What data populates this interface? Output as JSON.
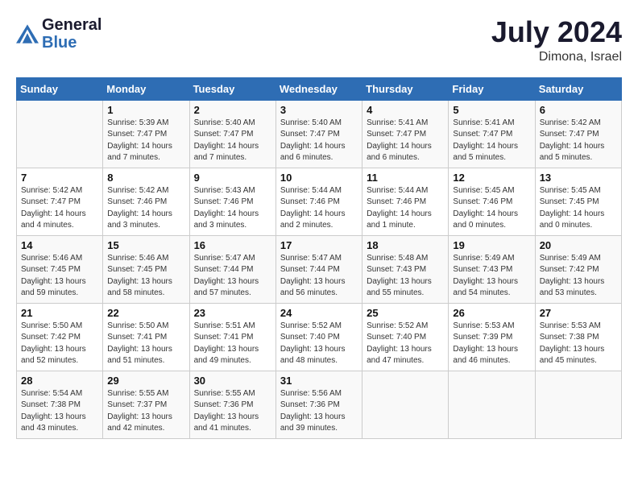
{
  "header": {
    "logo_line1": "General",
    "logo_line2": "Blue",
    "month": "July 2024",
    "location": "Dimona, Israel"
  },
  "days_of_week": [
    "Sunday",
    "Monday",
    "Tuesday",
    "Wednesday",
    "Thursday",
    "Friday",
    "Saturday"
  ],
  "weeks": [
    [
      {
        "day": "",
        "info": ""
      },
      {
        "day": "1",
        "info": "Sunrise: 5:39 AM\nSunset: 7:47 PM\nDaylight: 14 hours\nand 7 minutes."
      },
      {
        "day": "2",
        "info": "Sunrise: 5:40 AM\nSunset: 7:47 PM\nDaylight: 14 hours\nand 7 minutes."
      },
      {
        "day": "3",
        "info": "Sunrise: 5:40 AM\nSunset: 7:47 PM\nDaylight: 14 hours\nand 6 minutes."
      },
      {
        "day": "4",
        "info": "Sunrise: 5:41 AM\nSunset: 7:47 PM\nDaylight: 14 hours\nand 6 minutes."
      },
      {
        "day": "5",
        "info": "Sunrise: 5:41 AM\nSunset: 7:47 PM\nDaylight: 14 hours\nand 5 minutes."
      },
      {
        "day": "6",
        "info": "Sunrise: 5:42 AM\nSunset: 7:47 PM\nDaylight: 14 hours\nand 5 minutes."
      }
    ],
    [
      {
        "day": "7",
        "info": "Sunrise: 5:42 AM\nSunset: 7:47 PM\nDaylight: 14 hours\nand 4 minutes."
      },
      {
        "day": "8",
        "info": "Sunrise: 5:42 AM\nSunset: 7:46 PM\nDaylight: 14 hours\nand 3 minutes."
      },
      {
        "day": "9",
        "info": "Sunrise: 5:43 AM\nSunset: 7:46 PM\nDaylight: 14 hours\nand 3 minutes."
      },
      {
        "day": "10",
        "info": "Sunrise: 5:44 AM\nSunset: 7:46 PM\nDaylight: 14 hours\nand 2 minutes."
      },
      {
        "day": "11",
        "info": "Sunrise: 5:44 AM\nSunset: 7:46 PM\nDaylight: 14 hours\nand 1 minute."
      },
      {
        "day": "12",
        "info": "Sunrise: 5:45 AM\nSunset: 7:46 PM\nDaylight: 14 hours\nand 0 minutes."
      },
      {
        "day": "13",
        "info": "Sunrise: 5:45 AM\nSunset: 7:45 PM\nDaylight: 14 hours\nand 0 minutes."
      }
    ],
    [
      {
        "day": "14",
        "info": "Sunrise: 5:46 AM\nSunset: 7:45 PM\nDaylight: 13 hours\nand 59 minutes."
      },
      {
        "day": "15",
        "info": "Sunrise: 5:46 AM\nSunset: 7:45 PM\nDaylight: 13 hours\nand 58 minutes."
      },
      {
        "day": "16",
        "info": "Sunrise: 5:47 AM\nSunset: 7:44 PM\nDaylight: 13 hours\nand 57 minutes."
      },
      {
        "day": "17",
        "info": "Sunrise: 5:47 AM\nSunset: 7:44 PM\nDaylight: 13 hours\nand 56 minutes."
      },
      {
        "day": "18",
        "info": "Sunrise: 5:48 AM\nSunset: 7:43 PM\nDaylight: 13 hours\nand 55 minutes."
      },
      {
        "day": "19",
        "info": "Sunrise: 5:49 AM\nSunset: 7:43 PM\nDaylight: 13 hours\nand 54 minutes."
      },
      {
        "day": "20",
        "info": "Sunrise: 5:49 AM\nSunset: 7:42 PM\nDaylight: 13 hours\nand 53 minutes."
      }
    ],
    [
      {
        "day": "21",
        "info": "Sunrise: 5:50 AM\nSunset: 7:42 PM\nDaylight: 13 hours\nand 52 minutes."
      },
      {
        "day": "22",
        "info": "Sunrise: 5:50 AM\nSunset: 7:41 PM\nDaylight: 13 hours\nand 51 minutes."
      },
      {
        "day": "23",
        "info": "Sunrise: 5:51 AM\nSunset: 7:41 PM\nDaylight: 13 hours\nand 49 minutes."
      },
      {
        "day": "24",
        "info": "Sunrise: 5:52 AM\nSunset: 7:40 PM\nDaylight: 13 hours\nand 48 minutes."
      },
      {
        "day": "25",
        "info": "Sunrise: 5:52 AM\nSunset: 7:40 PM\nDaylight: 13 hours\nand 47 minutes."
      },
      {
        "day": "26",
        "info": "Sunrise: 5:53 AM\nSunset: 7:39 PM\nDaylight: 13 hours\nand 46 minutes."
      },
      {
        "day": "27",
        "info": "Sunrise: 5:53 AM\nSunset: 7:38 PM\nDaylight: 13 hours\nand 45 minutes."
      }
    ],
    [
      {
        "day": "28",
        "info": "Sunrise: 5:54 AM\nSunset: 7:38 PM\nDaylight: 13 hours\nand 43 minutes."
      },
      {
        "day": "29",
        "info": "Sunrise: 5:55 AM\nSunset: 7:37 PM\nDaylight: 13 hours\nand 42 minutes."
      },
      {
        "day": "30",
        "info": "Sunrise: 5:55 AM\nSunset: 7:36 PM\nDaylight: 13 hours\nand 41 minutes."
      },
      {
        "day": "31",
        "info": "Sunrise: 5:56 AM\nSunset: 7:36 PM\nDaylight: 13 hours\nand 39 minutes."
      },
      {
        "day": "",
        "info": ""
      },
      {
        "day": "",
        "info": ""
      },
      {
        "day": "",
        "info": ""
      }
    ]
  ]
}
